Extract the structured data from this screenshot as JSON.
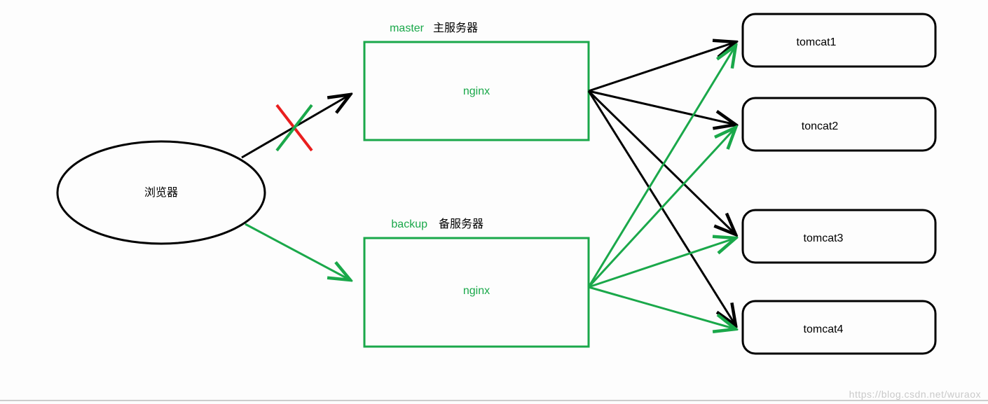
{
  "browser": {
    "label": "浏览器"
  },
  "nginx_master": {
    "badge": "master",
    "badge_sub": "主服务器",
    "label": "nginx"
  },
  "nginx_backup": {
    "badge": "backup",
    "badge_sub": "备服务器",
    "label": "nginx"
  },
  "tomcats": {
    "t1": "tomcat1",
    "t2": "toncat2",
    "t3": "tomcat3",
    "t4": "tomcat4"
  },
  "watermark": "https://blog.csdn.net/wuraox",
  "colors": {
    "green": "#1aa84a",
    "red": "#e91e1e",
    "black": "#000000"
  }
}
